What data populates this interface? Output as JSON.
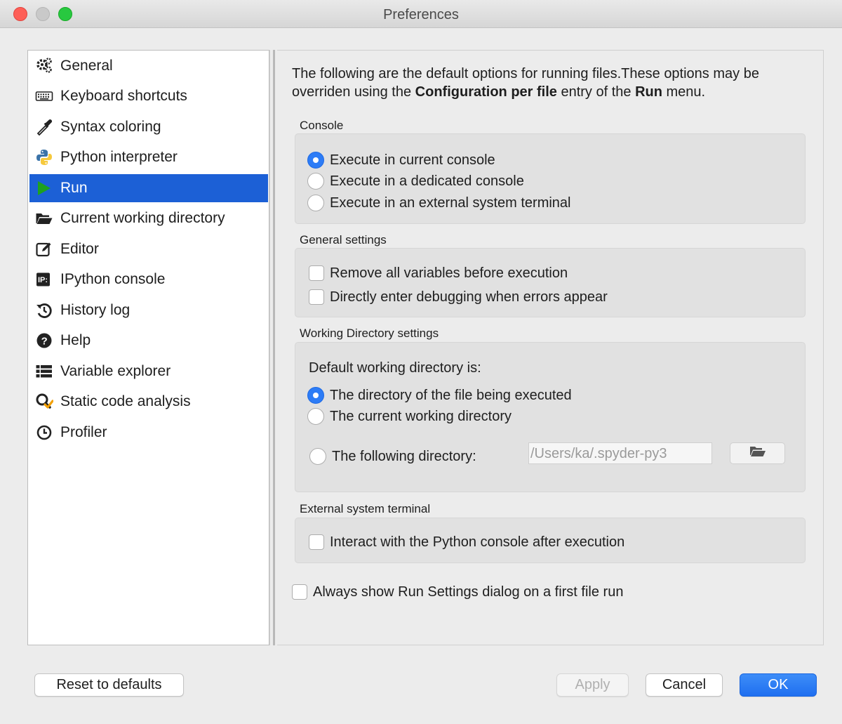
{
  "window": {
    "title": "Preferences"
  },
  "sidebar": {
    "items": [
      {
        "label": "General",
        "icon": "gears-icon"
      },
      {
        "label": "Keyboard shortcuts",
        "icon": "keyboard-icon"
      },
      {
        "label": "Syntax coloring",
        "icon": "eyedropper-icon"
      },
      {
        "label": "Python interpreter",
        "icon": "python-icon"
      },
      {
        "label": "Run",
        "icon": "play-icon",
        "selected": true
      },
      {
        "label": "Current working directory",
        "icon": "folder-open-icon"
      },
      {
        "label": "Editor",
        "icon": "edit-icon"
      },
      {
        "label": "IPython console",
        "icon": "ipython-icon"
      },
      {
        "label": "History log",
        "icon": "history-icon"
      },
      {
        "label": "Help",
        "icon": "help-icon"
      },
      {
        "label": "Variable explorer",
        "icon": "table-list-icon"
      },
      {
        "label": "Static code analysis",
        "icon": "code-analysis-icon"
      },
      {
        "label": "Profiler",
        "icon": "clock-icon"
      }
    ]
  },
  "intro": {
    "part1": "The following are the default options for running files.These options may be overriden using the ",
    "bold1": "Configuration per file",
    "part2": " entry of the ",
    "bold2": "Run",
    "part3": " menu."
  },
  "console": {
    "title": "Console",
    "options": [
      {
        "label": "Execute in current console",
        "selected": true
      },
      {
        "label": "Execute in a dedicated console",
        "selected": false
      },
      {
        "label": "Execute in an external system terminal",
        "selected": false
      }
    ]
  },
  "general_settings": {
    "title": "General settings",
    "options": [
      {
        "label": "Remove all variables before execution",
        "checked": false
      },
      {
        "label": "Directly enter debugging when errors appear",
        "checked": false
      }
    ]
  },
  "working_directory": {
    "title": "Working Directory settings",
    "subtitle": "Default working directory is:",
    "options": [
      {
        "label": "The directory of the file being executed",
        "selected": true
      },
      {
        "label": "The current working directory",
        "selected": false
      },
      {
        "label": "The following directory:",
        "selected": false
      }
    ],
    "directory_placeholder": "/Users/ka/.spyder-py3"
  },
  "external_terminal": {
    "title": "External system terminal",
    "options": [
      {
        "label": "Interact with the Python console after execution",
        "checked": false
      }
    ]
  },
  "always_show": {
    "label": "Always show Run Settings dialog on a first file run",
    "checked": false
  },
  "buttons": {
    "reset": "Reset to defaults",
    "apply": "Apply",
    "cancel": "Cancel",
    "ok": "OK"
  },
  "colors": {
    "selection": "#1c60d6",
    "primary_button": "#1f6ff0",
    "radio_selected": "#2d7cf6"
  }
}
